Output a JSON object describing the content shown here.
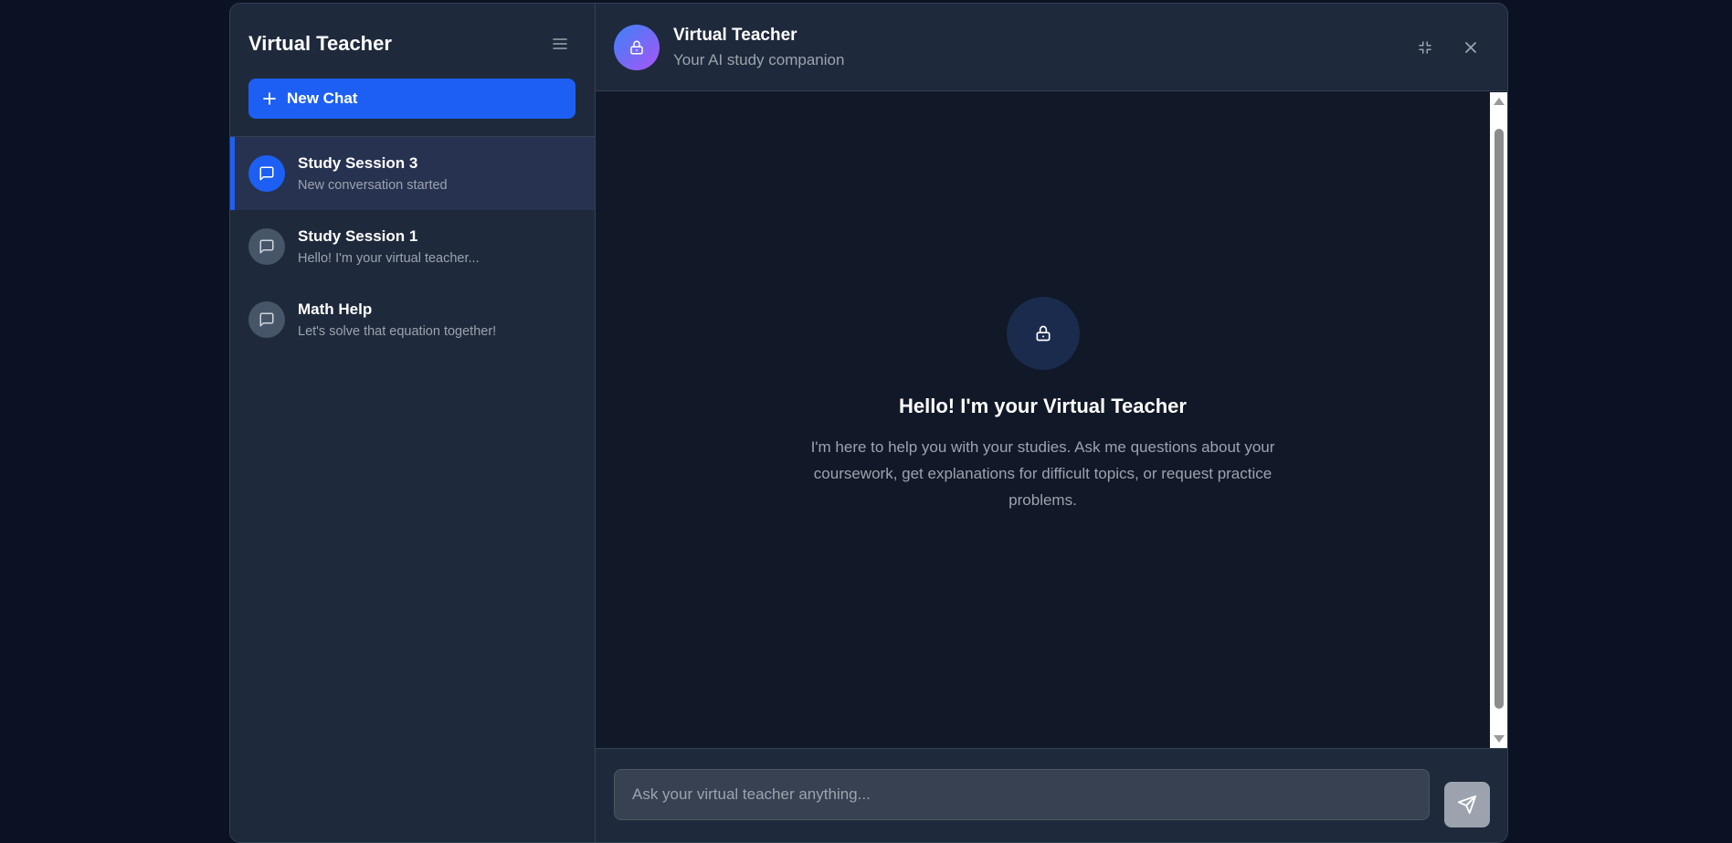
{
  "sidebar": {
    "title": "Virtual Teacher",
    "menu_icon": "menu-icon",
    "new_chat_label": "New Chat",
    "new_chat_icon": "plus-icon",
    "chats": [
      {
        "title": "Study Session 3",
        "preview": "New conversation started",
        "active": true,
        "icon": "message-square-icon"
      },
      {
        "title": "Study Session 1",
        "preview": "Hello! I'm your virtual teacher...",
        "active": false,
        "icon": "message-square-icon"
      },
      {
        "title": "Math Help",
        "preview": "Let's solve that equation together!",
        "active": false,
        "icon": "message-square-icon"
      }
    ]
  },
  "header": {
    "title": "Virtual Teacher",
    "subtitle": "Your AI study companion",
    "avatar_icon": "lock-icon",
    "minimize_icon": "minimize-icon",
    "close_icon": "close-icon"
  },
  "welcome": {
    "icon": "lock-icon",
    "title": "Hello! I'm your Virtual Teacher",
    "text": "I'm here to help you with your studies. Ask me questions about your coursework, get explanations for difficult topics, or request practice problems."
  },
  "composer": {
    "placeholder": "Ask your virtual teacher anything...",
    "value": "",
    "send_icon": "send-icon"
  },
  "colors": {
    "accent": "#1d5ff2",
    "background": "#111827",
    "panel": "#1e293b",
    "page": "#0b1223"
  }
}
